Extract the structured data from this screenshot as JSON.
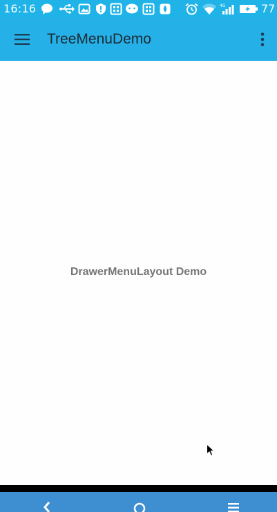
{
  "status_bar": {
    "time": "16:16",
    "battery_level": "77",
    "icons": [
      "chat-bubble-icon",
      "usb-icon",
      "image-icon",
      "shield-icon",
      "qr-icon",
      "messenger-icon",
      "qr-icon",
      "security-app-icon",
      "alarm-icon",
      "wifi-icon",
      "signal-icon",
      "battery-charging-icon"
    ]
  },
  "app_bar": {
    "title": "TreeMenuDemo",
    "menu_icon": "hamburger-icon",
    "overflow_icon": "more-vert-icon"
  },
  "main": {
    "label": "DrawerMenuLayout Demo"
  },
  "nav_bar": {
    "buttons": [
      "back-icon",
      "home-icon",
      "recents-icon"
    ]
  },
  "colors": {
    "status_bar": "#1fb3e8",
    "app_bar": "#26b0e8",
    "nav_bar": "#3e8ed2",
    "content_text": "#767676",
    "title_text": "#1c2a33"
  }
}
